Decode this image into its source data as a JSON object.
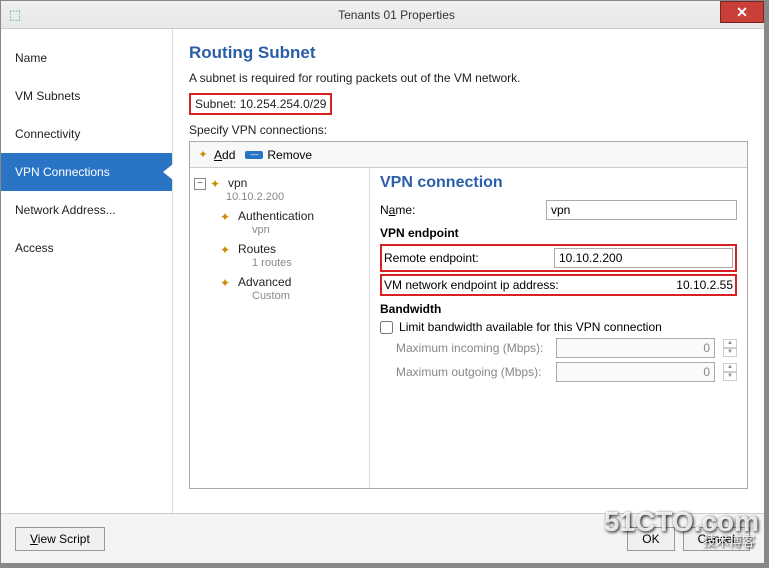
{
  "window": {
    "title": "Tenants 01 Properties"
  },
  "sidebar": {
    "items": [
      {
        "label": "Name"
      },
      {
        "label": "VM Subnets"
      },
      {
        "label": "Connectivity"
      },
      {
        "label": "VPN Connections"
      },
      {
        "label": "Network Address..."
      },
      {
        "label": "Access"
      }
    ]
  },
  "main": {
    "title": "Routing Subnet",
    "desc": "A subnet is required for routing packets out of the VM network.",
    "subnet_label": "Subnet:",
    "subnet_value": "10.254.254.0/29",
    "specify_label": "Specify VPN connections:"
  },
  "toolbar": {
    "add": "Add",
    "remove": "Remove"
  },
  "tree": {
    "root": {
      "name": "vpn",
      "addr": "10.10.2.200"
    },
    "children": [
      {
        "name": "Authentication",
        "sub": "vpn"
      },
      {
        "name": "Routes",
        "sub": "1 routes"
      },
      {
        "name": "Advanced",
        "sub": "Custom"
      }
    ]
  },
  "detail": {
    "title": "VPN connection",
    "name_label": "Name:",
    "name_value": "vpn",
    "endpoint_header": "VPN endpoint",
    "remote_label": "Remote endpoint:",
    "remote_value": "10.10.2.200",
    "vm_ep_label": "VM network endpoint ip address:",
    "vm_ep_value": "10.10.2.55",
    "bw_header": "Bandwidth",
    "bw_limit_label": "Limit bandwidth available for this VPN connection",
    "bw_in_label": "Maximum incoming (Mbps):",
    "bw_in_value": "0",
    "bw_out_label": "Maximum outgoing (Mbps):",
    "bw_out_value": "0"
  },
  "footer": {
    "view_script": "View Script",
    "ok": "OK",
    "cancel": "Cancel"
  },
  "watermark": {
    "main": "51CTO.com",
    "sub": "技术博客"
  }
}
